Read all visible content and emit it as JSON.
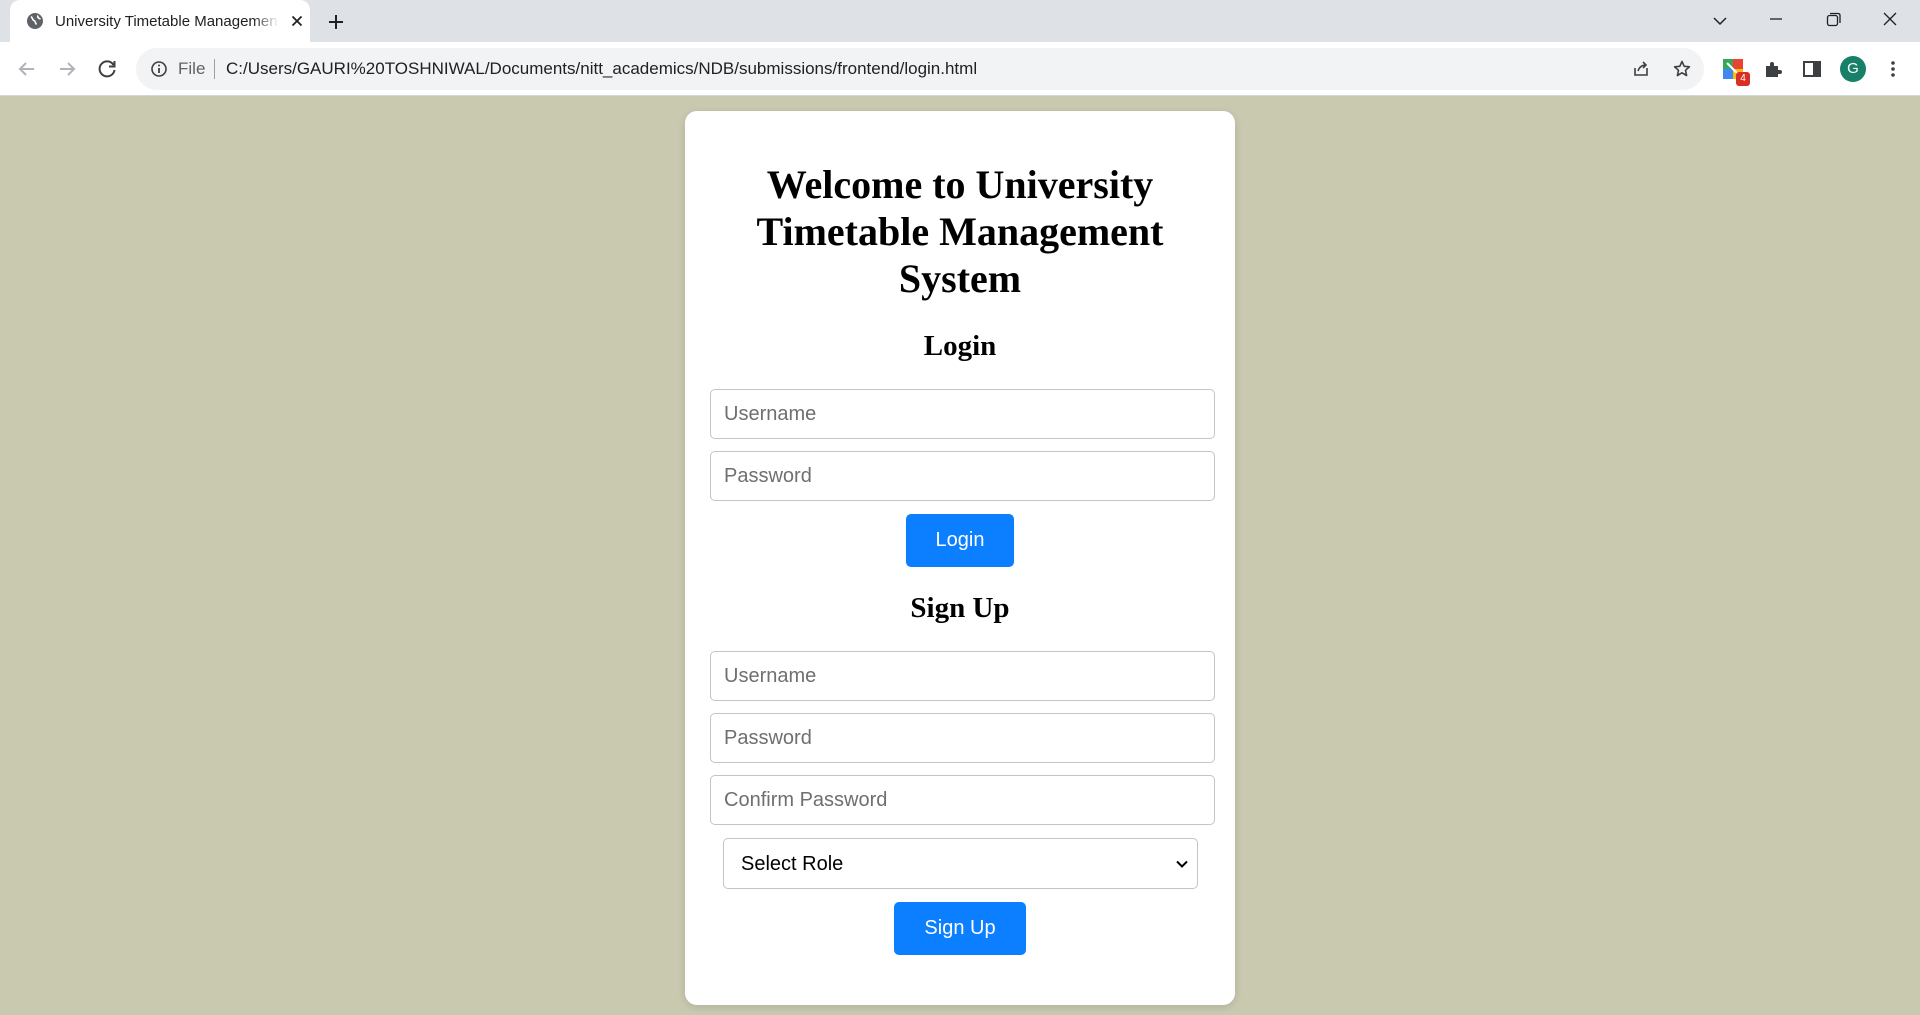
{
  "browser": {
    "tab": {
      "title": "University Timetable Management System",
      "favicon_icon": "globe-icon"
    },
    "address_bar": {
      "scheme_label": "File",
      "url": "C:/Users/GAURI%20TOSHNIWAL/Documents/nitt_academics/NDB/submissions/frontend/login.html"
    },
    "extension_badge": "4",
    "profile_initial": "G"
  },
  "page": {
    "background_color": "#c9c9b0",
    "accent_color": "#0b7fff",
    "heading": "Welcome to University Timetable Management System",
    "login": {
      "title": "Login",
      "username_placeholder": "Username",
      "password_placeholder": "Password",
      "button_label": "Login"
    },
    "signup": {
      "title": "Sign Up",
      "username_placeholder": "Username",
      "password_placeholder": "Password",
      "confirm_placeholder": "Confirm Password",
      "role_select": "Select Role",
      "button_label": "Sign Up"
    }
  }
}
